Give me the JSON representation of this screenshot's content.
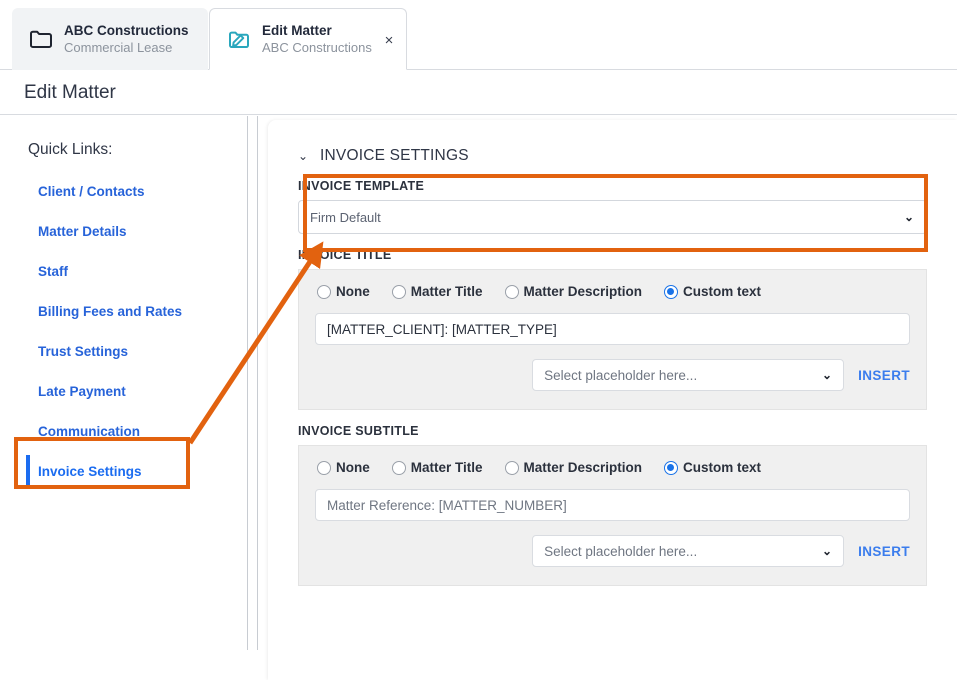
{
  "window": {
    "tabs": [
      {
        "title": "ABC Constructions",
        "subtitle": "Commercial Lease",
        "icon": "folder-icon",
        "active": false
      },
      {
        "title": "Edit Matter",
        "subtitle": "ABC Constructions",
        "icon": "folder-edit-icon",
        "active": true,
        "close_label": "×"
      }
    ]
  },
  "header": {
    "title": "Edit Matter"
  },
  "sidebar": {
    "heading": "Quick Links:",
    "items": [
      {
        "label": "Client / Contacts",
        "active": false
      },
      {
        "label": "Matter Details",
        "active": false
      },
      {
        "label": "Staff",
        "active": false
      },
      {
        "label": "Billing Fees and Rates",
        "active": false
      },
      {
        "label": "Trust Settings",
        "active": false
      },
      {
        "label": "Late Payment",
        "active": false
      },
      {
        "label": "Communication",
        "active": false
      },
      {
        "label": "Invoice Settings",
        "active": true
      }
    ]
  },
  "main": {
    "section": {
      "caret": "⌄",
      "title": "INVOICE SETTINGS"
    },
    "invoice_template": {
      "label": "INVOICE TEMPLATE",
      "value": "Firm Default",
      "chevron": "⌄"
    },
    "invoice_title": {
      "label": "INVOICE TITLE",
      "options": [
        {
          "label": "None",
          "checked": false
        },
        {
          "label": "Matter Title",
          "checked": false
        },
        {
          "label": "Matter Description",
          "checked": false
        },
        {
          "label": "Custom text",
          "checked": true
        }
      ],
      "custom_text_value": "[MATTER_CLIENT]: [MATTER_TYPE]",
      "placeholder_select": "Select placeholder here...",
      "placeholder_chevron": "⌄",
      "insert_label": "INSERT"
    },
    "invoice_subtitle": {
      "label": "INVOICE SUBTITLE",
      "options": [
        {
          "label": "None",
          "checked": false
        },
        {
          "label": "Matter Title",
          "checked": false
        },
        {
          "label": "Matter Description",
          "checked": false
        },
        {
          "label": "Custom text",
          "checked": true
        }
      ],
      "custom_text_value": "Matter Reference: [MATTER_NUMBER]",
      "placeholder_select": "Select placeholder here...",
      "placeholder_chevron": "⌄",
      "insert_label": "INSERT"
    }
  },
  "annotations": {
    "highlight_color": "#e2620f",
    "boxes": [
      {
        "name": "invoice-template-highlight"
      },
      {
        "name": "invoice-settings-link-highlight"
      }
    ],
    "arrow": {
      "from": "invoice-settings-link-highlight",
      "to": "invoice-template-highlight"
    }
  },
  "colors": {
    "link_blue": "#2763d9",
    "active_blue": "#1b6cf0",
    "radio_blue": "#1a73e8",
    "tab_icon_teal": "#2aa7bd",
    "annotation_orange": "#e2620f",
    "panel_gray": "#f0f0f0"
  }
}
